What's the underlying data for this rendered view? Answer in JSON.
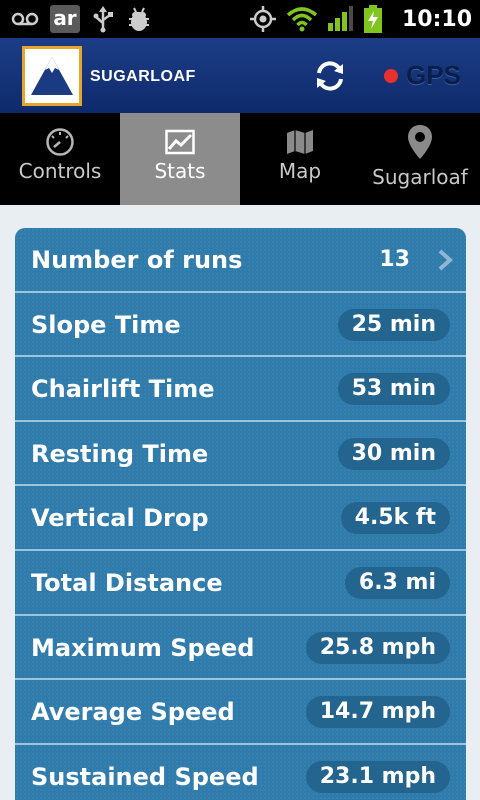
{
  "status_bar": {
    "ar_label": "ar",
    "time": "10:10",
    "icons": [
      "voicemail-icon",
      "ar-app-icon",
      "usb-icon",
      "debug-icon",
      "gps-status-icon",
      "wifi-icon",
      "signal-icon",
      "battery-charging-icon"
    ]
  },
  "header": {
    "logo_text": "SUGARLOAF",
    "refresh_icon": "refresh-icon",
    "gps_label": "GPS",
    "gps_indicator_color": "#e8302d"
  },
  "tabs": [
    {
      "label": "Controls",
      "icon": "gauge-icon",
      "active": false
    },
    {
      "label": "Stats",
      "icon": "chart-icon",
      "active": true
    },
    {
      "label": "Map",
      "icon": "map-icon",
      "active": false
    },
    {
      "label": "Sugarloaf",
      "icon": "location-pin-icon",
      "active": false
    }
  ],
  "stats": {
    "rows": [
      {
        "label": "Number of runs",
        "value": "13"
      },
      {
        "label": "Slope Time",
        "value": "25 min"
      },
      {
        "label": "Chairlift Time",
        "value": "53 min"
      },
      {
        "label": "Resting Time",
        "value": "30 min"
      },
      {
        "label": "Vertical Drop",
        "value": "4.5k ft"
      },
      {
        "label": "Total Distance",
        "value": "6.3 mi"
      },
      {
        "label": "Maximum Speed",
        "value": "25.8 mph"
      },
      {
        "label": "Average Speed",
        "value": "14.7 mph"
      },
      {
        "label": "Sustained Speed",
        "value": "23.1 mph"
      }
    ]
  },
  "colors": {
    "panel": "#2f7bab",
    "pill": "#23658f",
    "header": "#1c3d86",
    "active_tab": "#8c8c8c",
    "logo_border": "#e8a52b"
  }
}
